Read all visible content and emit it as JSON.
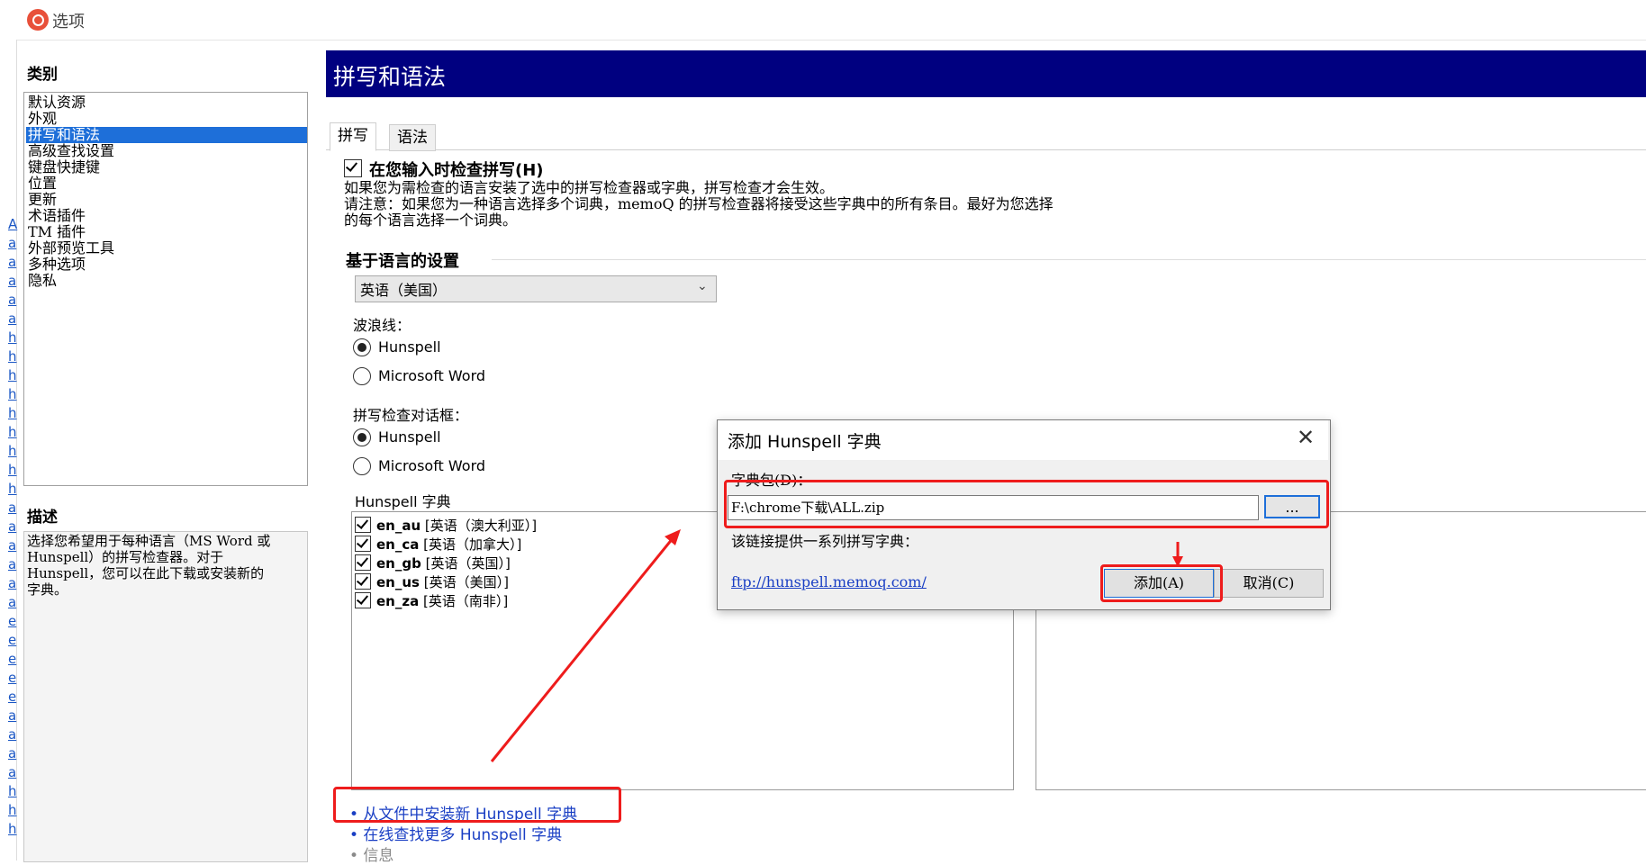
{
  "window": {
    "title": "选项"
  },
  "left_strip_chars": [
    "A",
    "a",
    "a",
    "a",
    "a",
    "a",
    "h",
    "h",
    "h",
    "h",
    "h",
    "h",
    "h",
    "h",
    "h",
    "a",
    "a",
    "a",
    "a",
    "a",
    "a",
    "e",
    "e",
    "e",
    "e",
    "e",
    "a",
    "a",
    "a",
    "a",
    "h",
    "h",
    "h"
  ],
  "categories": {
    "label": "类别",
    "items": [
      "默认资源",
      "外观",
      "拼写和语法",
      "高级查找设置",
      "键盘快捷键",
      "位置",
      "更新",
      "术语插件",
      "TM 插件",
      "外部预览工具",
      "多种选项",
      "隐私"
    ],
    "selected_index": 2
  },
  "description": {
    "label": "描述",
    "lines": [
      "选择您希望用于每种语言（MS Word 或",
      "Hunspell）的拼写检查器。对于",
      "Hunspell，您可以在此下载或安装新的",
      "字典。"
    ]
  },
  "content": {
    "title": "拼写和语法",
    "tabs": [
      "拼写",
      "语法"
    ],
    "active_tab": 0,
    "check_spelling": {
      "label": "在您输入时检查拼写(H)",
      "checked": true
    },
    "info_lines": [
      "如果您为需检查的语言安装了选中的拼写检查器或字典，拼写检查才会生效。",
      "请注意：如果您为一种语言选择多个词典，memoQ 的拼写检查器将接受这些字典中的所有条目。最好为您选择",
      "的每个语言选择一个词典。"
    ],
    "group_title": "基于语言的设置",
    "language_select": "英语（美国）",
    "squiggle": {
      "label": "波浪线：",
      "options": [
        "Hunspell",
        "Microsoft Word"
      ],
      "selected": 0
    },
    "spell_dialog": {
      "label": "拼写检查对话框：",
      "options": [
        "Hunspell",
        "Microsoft Word"
      ],
      "selected": 0
    },
    "dictionaries": {
      "label": "Hunspell 字典",
      "items": [
        {
          "code": "en_au",
          "name": "[英语（澳大利亚）]",
          "checked": true
        },
        {
          "code": "en_ca",
          "name": "[英语（加拿大）]",
          "checked": true
        },
        {
          "code": "en_gb",
          "name": "[英语（英国）]",
          "checked": true
        },
        {
          "code": "en_us",
          "name": "[英语（美国）]",
          "checked": true
        },
        {
          "code": "en_za",
          "name": "[英语（南非）]",
          "checked": true
        }
      ]
    },
    "links": [
      "• 从文件中安装新 Hunspell 字典",
      "• 在线查找更多 Hunspell 字典",
      "• 信息"
    ]
  },
  "dialog": {
    "title": "添加 Hunspell 字典",
    "package_label": "字典包(D)：",
    "package_value": "F:\\chrome下载\\ALL.zip",
    "browse_label": "...",
    "link_info": "该链接提供一系列拼写字典：",
    "link": "ftp://hunspell.memoq.com/",
    "add_label": "添加(A)",
    "cancel_label": "取消(C)"
  },
  "colors": {
    "header_bg": "#000080",
    "selection": "#1e6fd9",
    "annotation": "#ee1c1c",
    "link": "#1a3fc4"
  }
}
